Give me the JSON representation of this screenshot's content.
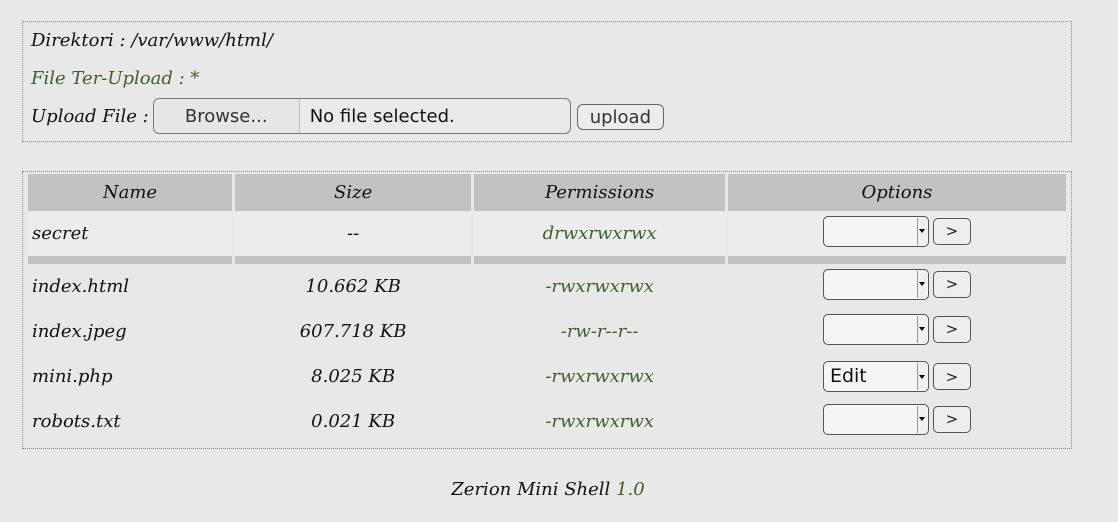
{
  "header": {
    "dir_label": "Direktori :",
    "dir_path": "/var/www/html/",
    "uploaded_label": "File Ter-Upload : *",
    "upload_label": "Upload File :",
    "browse_label": "Browse...",
    "no_file_text": "No file selected.",
    "upload_button": "upload"
  },
  "table": {
    "columns": [
      "Name",
      "Size",
      "Permissions",
      "Options"
    ],
    "dirs": [
      {
        "name": "secret",
        "size": "--",
        "perm": "drwxrwxrwx",
        "option": ""
      }
    ],
    "files": [
      {
        "name": "index.html",
        "size": "10.662 KB",
        "perm": "-rwxrwxrwx",
        "option": ""
      },
      {
        "name": "index.jpeg",
        "size": "607.718 KB",
        "perm": "-rw-r--r--",
        "option": ""
      },
      {
        "name": "mini.php",
        "size": "8.025 KB",
        "perm": "-rwxrwxrwx",
        "option": "Edit"
      },
      {
        "name": "robots.txt",
        "size": "0.021 KB",
        "perm": "-rwxrwxrwx",
        "option": ""
      }
    ],
    "go_label": ">"
  },
  "footer": {
    "text": "Zerion Mini Shell",
    "version": "1.0"
  },
  "colors": {
    "background": "#e8e8e8",
    "header_bg": "#c2c2c2",
    "accent_green": "#3f5f2a"
  }
}
